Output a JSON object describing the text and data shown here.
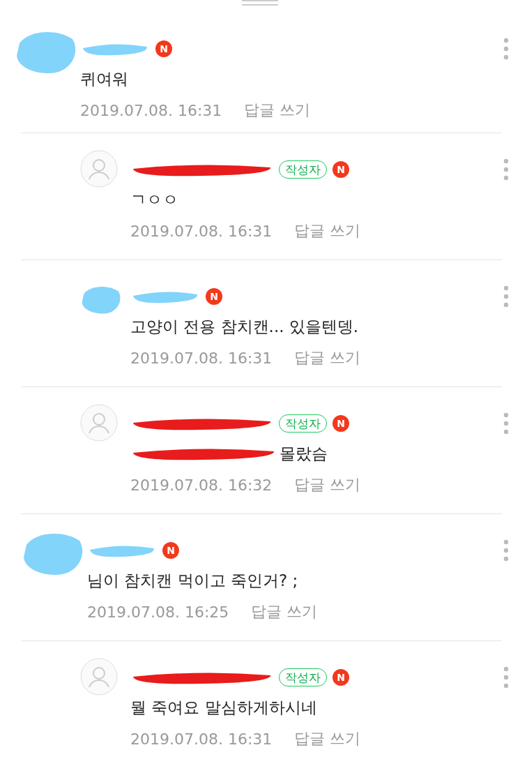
{
  "comments": [
    {
      "reply": false,
      "avatar_hidden": true,
      "new_badge": "N",
      "redacted_prefix": false,
      "text": "퀴여워",
      "time": "2019.07.08. 16:31",
      "reply_link": "답글 쓰기"
    },
    {
      "reply": true,
      "avatar_hidden": false,
      "author_badge": "작성자",
      "new_badge": "N",
      "redacted_prefix": false,
      "text": "ㄱㅇㅇ",
      "time": "2019.07.08. 16:31",
      "reply_link": "답글 쓰기"
    },
    {
      "reply": true,
      "avatar_hidden": true,
      "new_badge": "N",
      "redacted_prefix": false,
      "text": "고양이 전용 참치캔... 있을텐뎅.",
      "time": "2019.07.08. 16:31",
      "reply_link": "답글 쓰기"
    },
    {
      "reply": true,
      "avatar_hidden": false,
      "author_badge": "작성자",
      "new_badge": "N",
      "redacted_prefix": true,
      "text": "몰랐슴",
      "time": "2019.07.08. 16:32",
      "reply_link": "답글 쓰기"
    },
    {
      "reply": false,
      "avatar_hidden": true,
      "new_badge": "N",
      "redacted_prefix": false,
      "text": "님이 참치캔 먹이고 죽인거? ;",
      "time": "2019.07.08. 16:25",
      "reply_link": "답글 쓰기"
    },
    {
      "reply": true,
      "avatar_hidden": false,
      "author_badge": "작성자",
      "new_badge": "N",
      "redacted_prefix": false,
      "text": "뭘 죽여요 말심하게하시네",
      "time": "2019.07.08. 16:31",
      "reply_link": "답글 쓰기"
    }
  ]
}
